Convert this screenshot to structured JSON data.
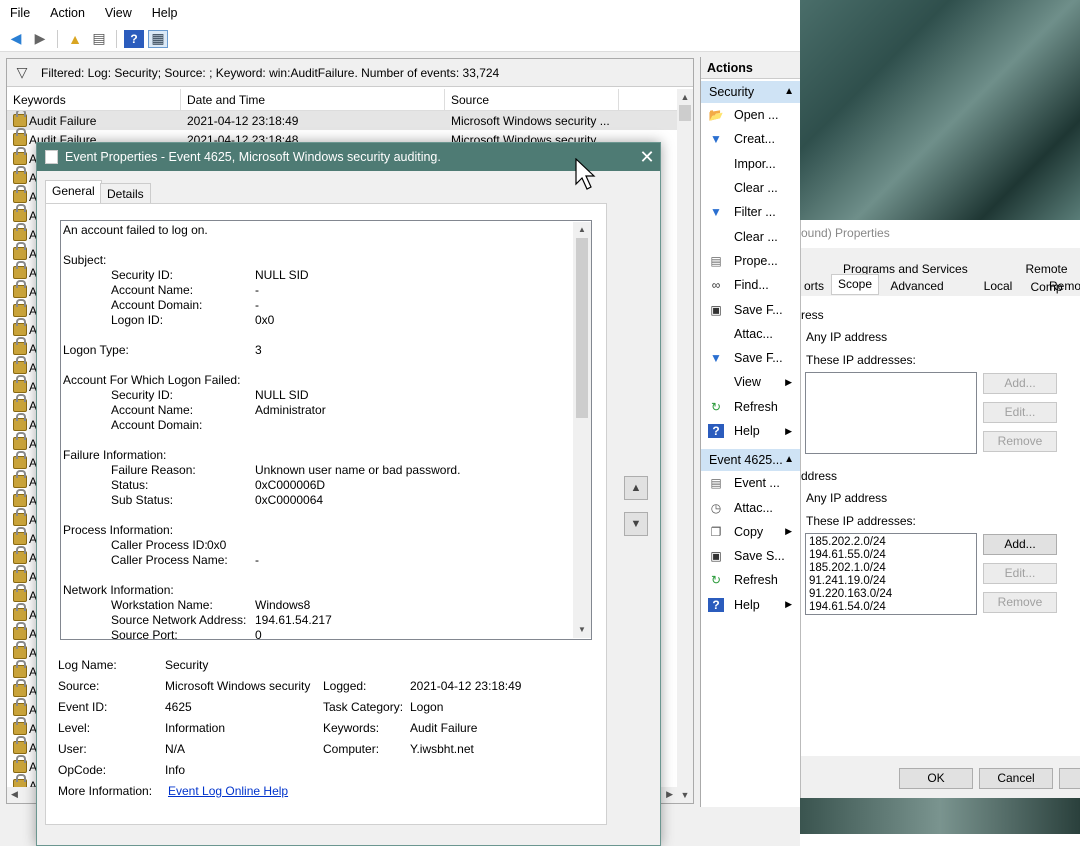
{
  "menu": [
    "File",
    "Action",
    "View",
    "Help"
  ],
  "filter_text": "Filtered: Log: Security; Source: ; Keyword: win:AuditFailure. Number of events: 33,724",
  "columns": {
    "keywords": "Keywords",
    "date": "Date and Time",
    "source": "Source"
  },
  "rows": [
    {
      "kw": "Audit Failure",
      "date": "2021-04-12 23:18:49",
      "src": "Microsoft Windows security ..."
    },
    {
      "kw": "Audit Failure",
      "date": "2021-04-12 23:18:48",
      "src": "Microsoft Windows security ..."
    }
  ],
  "row_stub": "A",
  "actions": {
    "header": "Actions",
    "section1": "Security",
    "items1": [
      {
        "label": "Open ...",
        "icon": "open-icon"
      },
      {
        "label": "Creat...",
        "icon": "filter-icon"
      },
      {
        "label": "Impor...",
        "icon": "blank"
      },
      {
        "label": "Clear ...",
        "icon": "blank"
      },
      {
        "label": "Filter ...",
        "icon": "filter-icon"
      },
      {
        "label": "Clear ...",
        "icon": "blank"
      },
      {
        "label": "Prope...",
        "icon": "properties-icon"
      },
      {
        "label": "Find...",
        "icon": "binoculars-icon"
      },
      {
        "label": "Save F...",
        "icon": "save-icon"
      },
      {
        "label": "Attac...",
        "icon": "blank"
      },
      {
        "label": "Save F...",
        "icon": "save-filter-icon"
      },
      {
        "label": "View",
        "icon": "blank",
        "submenu": true
      },
      {
        "label": "Refresh",
        "icon": "refresh-icon"
      },
      {
        "label": "Help",
        "icon": "help-icon",
        "submenu": true
      }
    ],
    "section2": "Event 4625...",
    "items2": [
      {
        "label": "Event ...",
        "icon": "event-icon"
      },
      {
        "label": "Attac...",
        "icon": "task-icon"
      },
      {
        "label": "Copy",
        "icon": "copy-icon",
        "submenu": true
      },
      {
        "label": "Save S...",
        "icon": "save-icon"
      },
      {
        "label": "Refresh",
        "icon": "refresh-icon"
      },
      {
        "label": "Help",
        "icon": "help-icon",
        "submenu": true
      }
    ]
  },
  "firewall": {
    "title": "ound) Properties",
    "tabs_row1": [
      "Programs and Services",
      "Remote Comp"
    ],
    "tabs_row2": [
      "orts",
      "Scope",
      "Advanced",
      "Local Principals",
      "Remo"
    ],
    "group1": "ress",
    "group2": "ddress",
    "any_ip": "Any IP address",
    "these_ip": "These IP addresses:",
    "add": "Add...",
    "edit": "Edit...",
    "remove": "Remove",
    "remote_ips": [
      "185.202.2.0/24",
      "194.61.55.0/24",
      "185.202.1.0/24",
      "91.241.19.0/24",
      "91.220.163.0/24",
      "194.61.54.0/24"
    ],
    "ok": "OK",
    "cancel": "Cancel"
  },
  "dialog": {
    "title": "Event Properties - Event 4625, Microsoft Windows security auditing.",
    "tab_general": "General",
    "tab_details": "Details",
    "description": {
      "intro": "An account failed to log on.",
      "subject": "Subject:",
      "subject_fields": [
        [
          "Security ID:",
          "NULL SID"
        ],
        [
          "Account Name:",
          "-"
        ],
        [
          "Account Domain:",
          "-"
        ],
        [
          "Logon ID:",
          "0x0"
        ]
      ],
      "logon_type_label": "Logon Type:",
      "logon_type": "3",
      "acct_failed": "Account For Which Logon Failed:",
      "acct_fields": [
        [
          "Security ID:",
          "NULL SID"
        ],
        [
          "Account Name:",
          "Administrator"
        ],
        [
          "Account Domain:",
          ""
        ]
      ],
      "failure": "Failure Information:",
      "failure_fields": [
        [
          "Failure Reason:",
          "Unknown user name or bad password."
        ],
        [
          "Status:",
          "0xC000006D"
        ],
        [
          "Sub Status:",
          "0xC0000064"
        ]
      ],
      "process": "Process Information:",
      "process_id_label": "Caller Process ID:",
      "process_id": "0x0",
      "process_name_label": "Caller Process Name:",
      "process_name": "-",
      "network": "Network Information:",
      "network_fields": [
        [
          "Workstation Name:",
          "Windows8"
        ],
        [
          "Source Network Address:",
          "194.61.54.217"
        ],
        [
          "Source Port:",
          "0"
        ]
      ]
    },
    "fields": {
      "log_name_label": "Log Name:",
      "log_name": "Security",
      "source_label": "Source:",
      "source": "Microsoft Windows security",
      "logged_label": "Logged:",
      "logged": "2021-04-12 23:18:49",
      "event_id_label": "Event ID:",
      "event_id": "4625",
      "task_label": "Task Category:",
      "task": "Logon",
      "level_label": "Level:",
      "level": "Information",
      "keywords_label": "Keywords:",
      "keywords": "Audit Failure",
      "user_label": "User:",
      "user": "N/A",
      "computer_label": "Computer:",
      "computer": "Y.iwsbht.net",
      "opcode_label": "OpCode:",
      "opcode": "Info",
      "more_label": "More Information:",
      "more_link": "Event Log Online Help"
    }
  }
}
